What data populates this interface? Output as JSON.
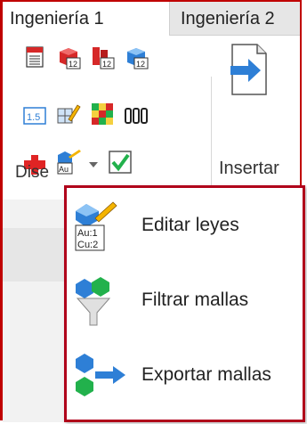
{
  "tabs": [
    {
      "label": "Ingeniería 1",
      "active": true
    },
    {
      "label": "Ingeniería 2",
      "active": false
    }
  ],
  "ribbon": {
    "insert_label": "Insertar",
    "group_label": "Dise",
    "icons": [
      "document-red-icon",
      "red-cube-12-icon",
      "red-layers-12-icon",
      "blue-cube-12-icon",
      "value-1-5-icon",
      "edit-grid-icon",
      "color-grid-icon",
      "data-columns-icon",
      "red-puzzle-icon",
      "grades-au-cu-icon",
      "dropdown-arrow-icon",
      "green-check-icon"
    ],
    "small_icon_texts": {
      "cube12": "12",
      "value": "1.5",
      "au": "Au"
    }
  },
  "dropdown": {
    "items": [
      {
        "label": "Editar leyes",
        "icon": "edit-grades-icon",
        "icon_text_1": "Au:1",
        "icon_text_2": "Cu:2"
      },
      {
        "label": "Filtrar mallas",
        "icon": "filter-meshes-icon"
      },
      {
        "label": "Exportar mallas",
        "icon": "export-meshes-icon"
      }
    ]
  },
  "colors": {
    "accent_border": "#b0001a",
    "blue": "#2e7fd6",
    "green": "#22b14c",
    "red": "#d62828"
  }
}
